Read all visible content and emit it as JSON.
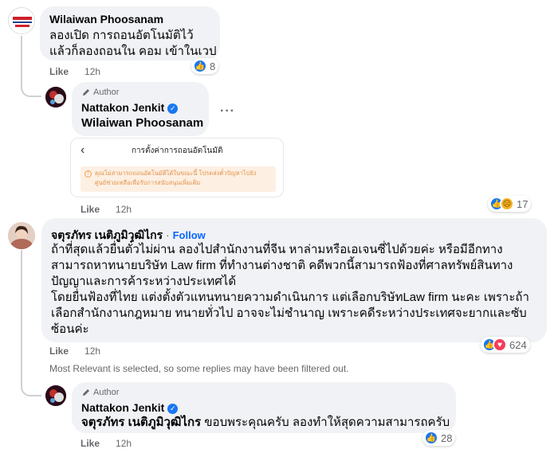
{
  "comment1": {
    "author": "Wilaiwan Phoosanam",
    "lines": [
      "ลองเปิด การถอนอัตโนมัติไว้",
      "แล้วก็ลองถอนใน คอม เข้าในเวป"
    ],
    "like": "Like",
    "time": "12h",
    "reaction_count": "8"
  },
  "reply1": {
    "badge": "Author",
    "author": "Nattakon Jenkit",
    "mention": "Wilaiwan Phoosanam",
    "like": "Like",
    "time": "12h",
    "reaction_count": "17",
    "screenshot": {
      "title": "การตั้งค่าการถอนอัตโนมัติ",
      "warning_line1": "คุณไม่สามารถถอนอัตโนมัติได้ในขณะนี้  โปรดส่งตั๋วปัญหาไปยัง",
      "warning_line2": "ศูนย์ช่วยเหลือเพื่อรับการสนับสนุนเพิ่มเติม"
    }
  },
  "comment2": {
    "author": "จตุรภัทร เนติภูมิวุฒิไกร",
    "separator": "·",
    "follow": "Follow",
    "lines": [
      "ถ้าที่สุดแล้วยื่นตั๋วไม่ผ่าน ลองไปสำนักงานที่จีน หาล่ามหรือเอเจนซี่ไปด้วยค่ะ หรือมีอีกทาง",
      "สามารถหาทนายบริษัท Law firm ที่ทำงานต่างชาติ คดีพวกนี้สามารถฟ้องที่ศาลทรัพย์สินทาง",
      "ปัญญาและการค้าระหว่างประเทศได้",
      "โดยยื่นฟ้องที่ไทย แต่งตั้งตัวแทนทนายความดำเนินการ แต่เลือกบริษัทLaw firm นะคะ เพราะถ้า",
      "เลือกสำนักงานกฎหมาย ทนายทั่วไป อาจจะไม่ชำนาญ เพราะคดีระหว่างประเทศจะยากและซับ",
      "ซ้อนค่ะ"
    ],
    "like": "Like",
    "time": "12h",
    "reaction_count": "624"
  },
  "filter_note": "Most Relevant is selected, so some replies may have been filtered out.",
  "reply2": {
    "badge": "Author",
    "author": "Nattakon Jenkit",
    "mention": "จตุรภัทร เนติภูมิวุฒิไกร",
    "text": " ขอบพระคุณครับ ลองทำให้สุดความสามารถครับ",
    "like": "Like",
    "time": "12h",
    "reaction_count": "28"
  },
  "icons": {
    "pencil": "pencil-icon",
    "verified": "verified-badge-icon",
    "like": "like-reaction-icon",
    "love": "love-reaction-icon",
    "sad": "sad-reaction-icon",
    "back": "chevron-left-icon",
    "more": "more-options-icon",
    "warning": "info-warning-icon"
  },
  "colors": {
    "link_blue": "#0866ff",
    "bubble_bg": "#f0f2f5",
    "like_blue": "#1877f2",
    "love_red": "#f33e58",
    "muted_text": "#65676b"
  }
}
